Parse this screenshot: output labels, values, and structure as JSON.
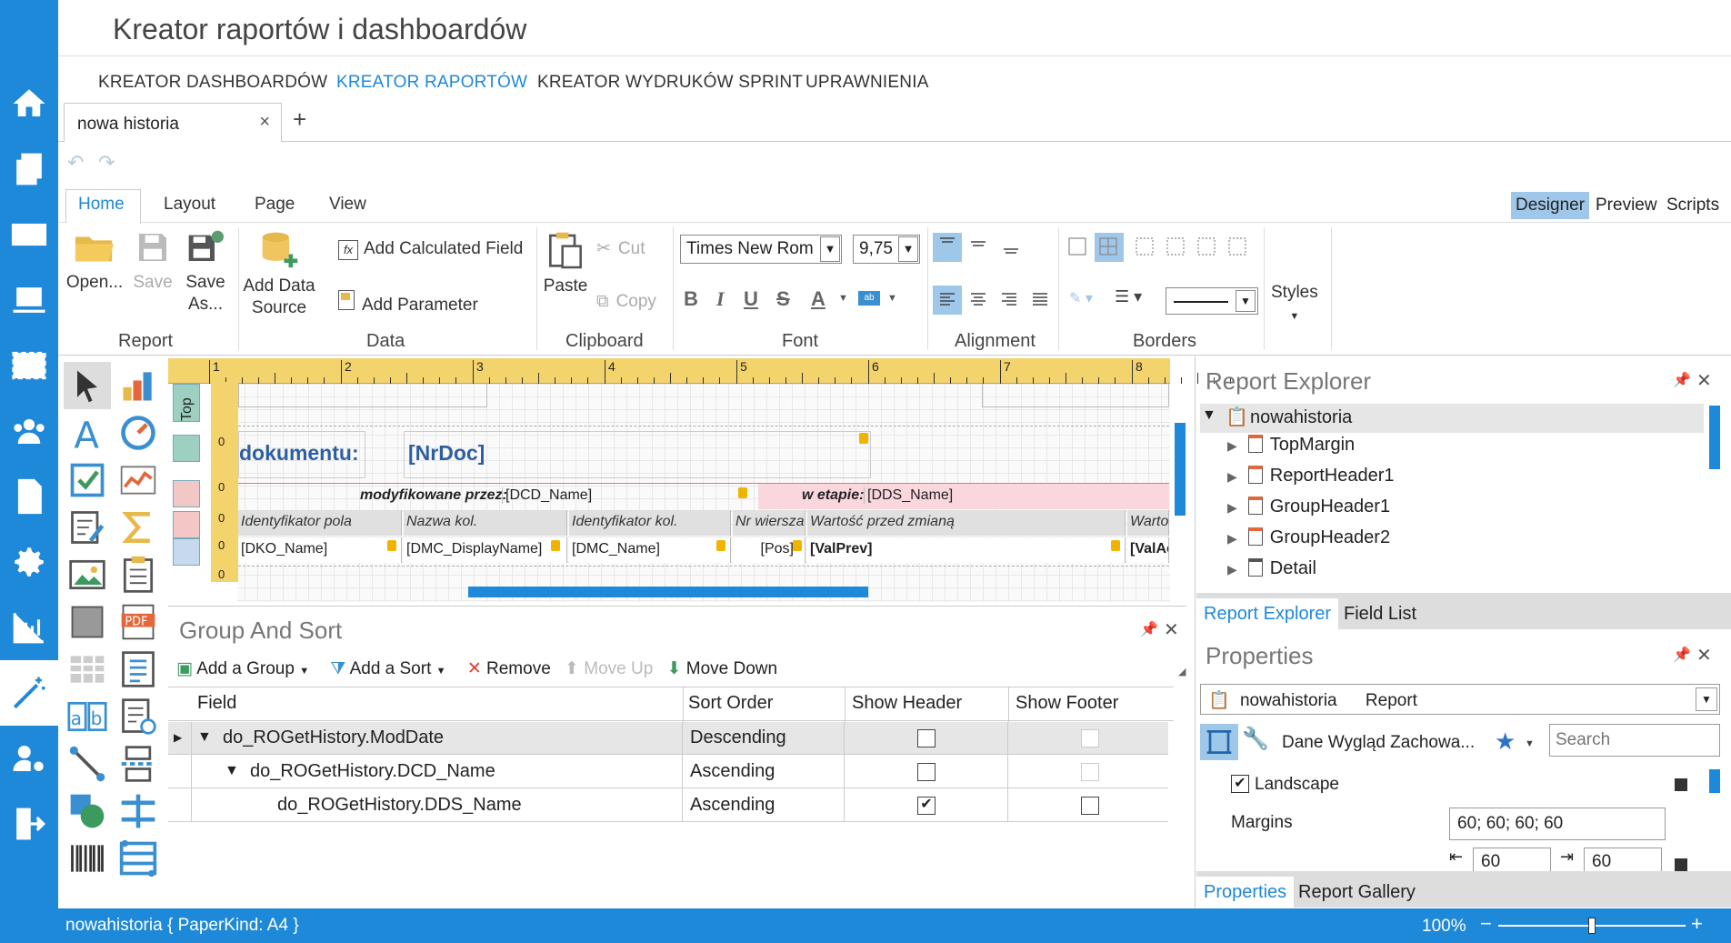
{
  "app": {
    "title": "Kreator raportów i dashboardów"
  },
  "main_nav": [
    "KREATOR DASHBOARDÓW",
    "KREATOR RAPORTÓW",
    "KREATOR WYDRUKÓW SPRINT",
    "UPRAWNIENIA"
  ],
  "doc_tab": {
    "label": "nowa historia",
    "close": "×",
    "add": "+"
  },
  "ribbon": {
    "tabs": [
      "Home",
      "Layout",
      "Page",
      "View"
    ],
    "view_modes": [
      "Designer",
      "Preview",
      "Scripts"
    ],
    "report": {
      "open": "Open...",
      "save": "Save",
      "save_as_1": "Save",
      "save_as_2": "As...",
      "group": "Report"
    },
    "data": {
      "add_ds_1": "Add Data",
      "add_ds_2": "Source",
      "calc": "Add Calculated Field",
      "param": "Add Parameter",
      "group": "Data"
    },
    "clipboard": {
      "paste": "Paste",
      "cut": "Cut",
      "copy": "Copy",
      "group": "Clipboard"
    },
    "font": {
      "family": "Times New Roman",
      "size": "9,75",
      "group": "Font",
      "bold": "B",
      "italic": "I",
      "underline": "U",
      "strike": "S",
      "color": "A",
      "highlight": "ab"
    },
    "alignment": {
      "group": "Alignment"
    },
    "borders": {
      "group": "Borders"
    },
    "styles": {
      "label": "Styles"
    }
  },
  "designer": {
    "ruler_marks": [
      "1",
      "2",
      "3",
      "4",
      "5",
      "6",
      "7",
      "8"
    ],
    "band_label": "Top",
    "band_zeros": [
      "0",
      "0",
      "0",
      "0",
      "0"
    ],
    "header_title": "dokumentu:",
    "nrdoc": "[NrDoc]",
    "modified_by_label": "modyfikowane przez:",
    "dcd_name": "[DCD_Name]",
    "stage_label": "w etapie:",
    "dds_name": "[DDS_Name]",
    "column_headers": [
      "Identyfikator pola",
      "Nazwa kol.",
      "Identyfikator kol.",
      "Nr wiersza",
      "Wartość przed zmianą",
      "Warto"
    ],
    "column_values": [
      "[DKO_Name]",
      "[DMC_DisplayName]",
      "[DMC_Name]",
      "[Pos]",
      "[ValPrev]",
      "[ValAc"
    ]
  },
  "group_sort": {
    "title": "Group And Sort",
    "toolbar": {
      "add_group": "Add a Group",
      "add_sort": "Add a Sort",
      "remove": "Remove",
      "move_up": "Move Up",
      "move_down": "Move Down"
    },
    "columns": [
      "Field",
      "Sort Order",
      "Show Header",
      "Show Footer"
    ],
    "rows": [
      {
        "field": "do_ROGetHistory.ModDate",
        "order": "Descending",
        "show_header": false,
        "show_footer": false
      },
      {
        "field": "do_ROGetHistory.DCD_Name",
        "order": "Ascending",
        "show_header": false,
        "show_footer": false
      },
      {
        "field": "do_ROGetHistory.DDS_Name",
        "order": "Ascending",
        "show_header": true,
        "show_footer": false
      }
    ]
  },
  "report_explorer": {
    "title": "Report Explorer",
    "root": "nowahistoria",
    "items": [
      "TopMargin",
      "ReportHeader1",
      "GroupHeader1",
      "GroupHeader2",
      "Detail"
    ],
    "tabs": [
      "Report Explorer",
      "Field List"
    ]
  },
  "properties": {
    "title": "Properties",
    "selector_name": "nowahistoria",
    "selector_type": "Report",
    "categories": "Dane  Wygląd  Zachowa...",
    "search_placeholder": "Search",
    "landscape_label": "Landscape",
    "landscape_checked": true,
    "margins_label": "Margins",
    "margins_value": "60; 60; 60; 60",
    "margin_left": "60",
    "margin_right": "60",
    "tabs": [
      "Properties",
      "Report Gallery"
    ]
  },
  "status": {
    "text": "nowahistoria { PaperKind: A4 }",
    "zoom": "100%",
    "zoom_level": 0.5
  },
  "colors": {
    "accent": "#1e88d9",
    "ruler": "#f3d36b",
    "header_text": "#2e5fa3"
  }
}
